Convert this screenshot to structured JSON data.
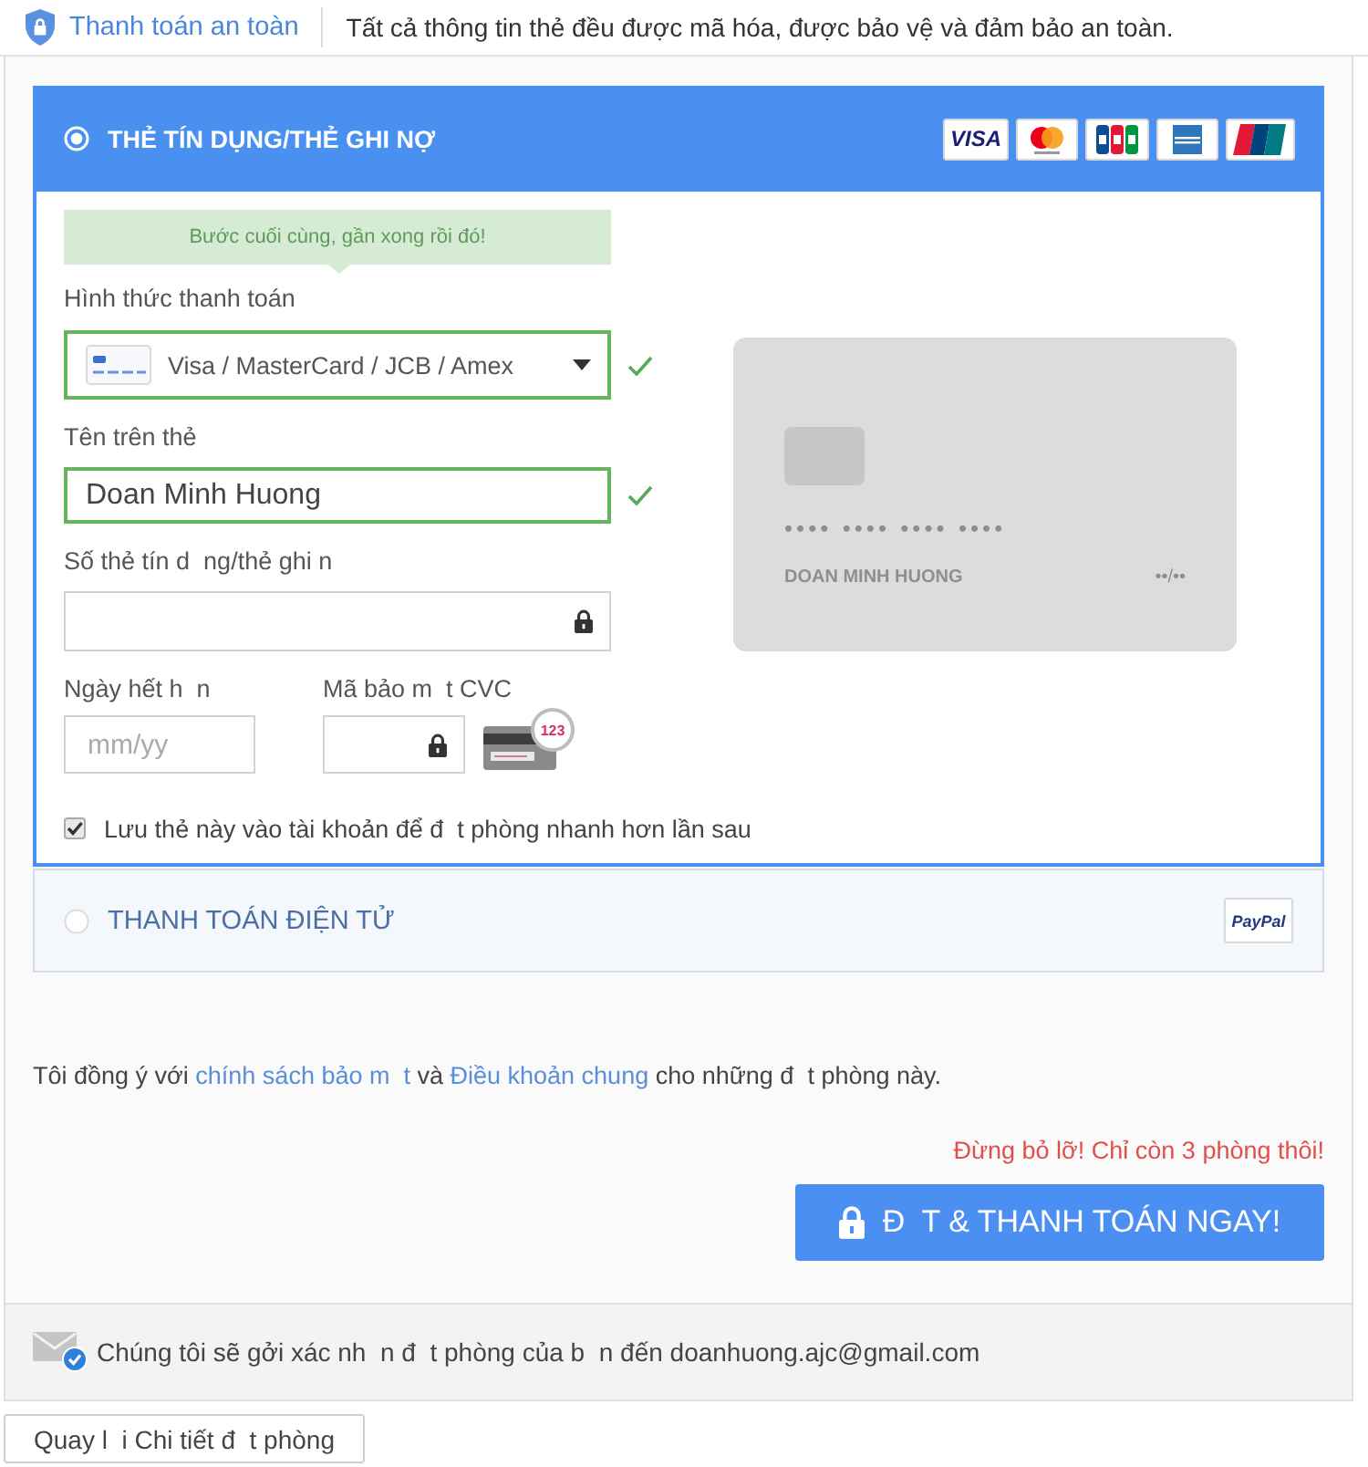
{
  "security_bar": {
    "title": "Thanh toán an toàn",
    "message": "Tất cả thông tin thẻ đều được mã hóa, được bảo vệ và đảm bảo an toàn."
  },
  "payment_methods": [
    {
      "kind": "card",
      "label": "THẺ TÍN DỤNG/THẺ GHI NỢ",
      "selected": true,
      "brands": [
        {
          "kind": "visa",
          "label": "VISA"
        },
        {
          "kind": "mastercard"
        },
        {
          "kind": "jcb"
        },
        {
          "kind": "amex"
        },
        {
          "kind": "unionpay"
        }
      ],
      "form": {
        "hint": "Bước cuối cùng, gần xong rồi đó!",
        "fields": [
          {
            "kind": "select",
            "label": "Hình thức thanh toán",
            "value": "Visa / MasterCard / JCB / Amex",
            "valid": true
          },
          {
            "kind": "text",
            "label": "Tên trên thẻ",
            "value": "Doan Minh Huong",
            "valid": true
          },
          {
            "kind": "secure",
            "label": "Số thẻ tín d  ng/thẻ ghi n",
            "valid": false
          }
        ],
        "expiry": {
          "label": "Ngày hết h  n",
          "placeholder": "mm/yy"
        },
        "cvc": {
          "label": "Mã bảo m  t CVC",
          "badge": "123"
        },
        "save_card": {
          "label": "Lưu thẻ này vào tài khoản để đ  t phòng nhanh hơn lần sau",
          "checked": true
        },
        "preview": {
          "number_mask": "•••• •••• •••• ••••",
          "name": "DOAN MINH HUONG",
          "expiry_mask": "••/••"
        }
      }
    },
    {
      "kind": "ewallet",
      "label": "THANH TOÁN ĐIỆN TỬ",
      "selected": false,
      "brands": [
        {
          "kind": "paypal",
          "label": "PayPal"
        }
      ]
    }
  ],
  "agreement": {
    "segments": [
      {
        "kind": "text",
        "text": "Tôi đồng ý với "
      },
      {
        "kind": "link",
        "text": "chính sách bảo m  t"
      },
      {
        "kind": "text",
        "text": " và "
      },
      {
        "kind": "link",
        "text": "Điều khoản chung"
      },
      {
        "kind": "text",
        "text": " cho những đ  t phòng này."
      }
    ]
  },
  "urgency": "Đừng bỏ lỡ! Chỉ còn 3 phòng thôi!",
  "submit_button": "Đ  T & THANH TOÁN NGAY!",
  "confirmation_note": "Chúng tôi sẽ gởi xác nh  n đ  t phòng của b  n đến doanhuong.ajc@gmail.com",
  "back_button": "Quay l  i Chi tiết đ  t phòng"
}
